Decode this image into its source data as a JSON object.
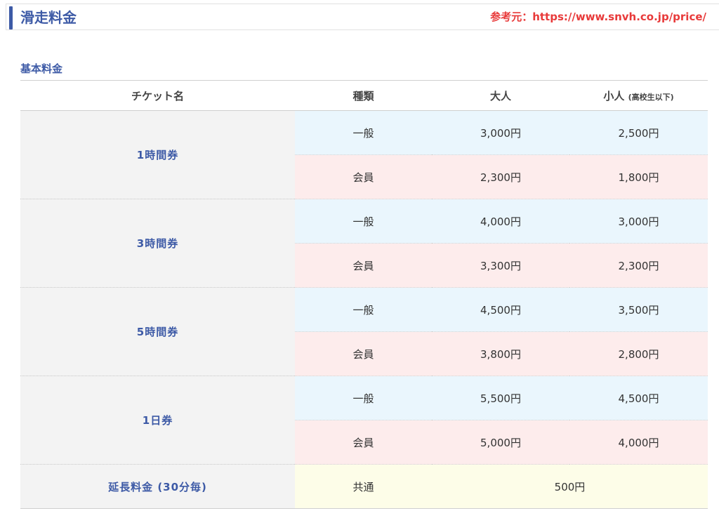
{
  "header": {
    "title": "滑走料金",
    "source": "参考元：https://www.snvh.co.jp/price/"
  },
  "section_title": "基本料金",
  "table": {
    "headers": {
      "ticket": "チケット名",
      "kind": "種類",
      "adult": "大人",
      "child": "小人",
      "child_note": "(高校生以下)"
    },
    "groups": [
      {
        "ticket": "1時間券",
        "rows": [
          {
            "kind": "一般",
            "adult": "3,000円",
            "child": "2,500円"
          },
          {
            "kind": "会員",
            "adult": "2,300円",
            "child": "1,800円"
          }
        ]
      },
      {
        "ticket": "3時間券",
        "rows": [
          {
            "kind": "一般",
            "adult": "4,000円",
            "child": "3,000円"
          },
          {
            "kind": "会員",
            "adult": "3,300円",
            "child": "2,300円"
          }
        ]
      },
      {
        "ticket": "5時間券",
        "rows": [
          {
            "kind": "一般",
            "adult": "4,500円",
            "child": "3,500円"
          },
          {
            "kind": "会員",
            "adult": "3,800円",
            "child": "2,800円"
          }
        ]
      },
      {
        "ticket": "1日券",
        "rows": [
          {
            "kind": "一般",
            "adult": "5,500円",
            "child": "4,500円"
          },
          {
            "kind": "会員",
            "adult": "5,000円",
            "child": "4,000円"
          }
        ]
      }
    ],
    "extension": {
      "ticket": "延長料金 (30分毎)",
      "kind": "共通",
      "price": "500円"
    }
  }
}
